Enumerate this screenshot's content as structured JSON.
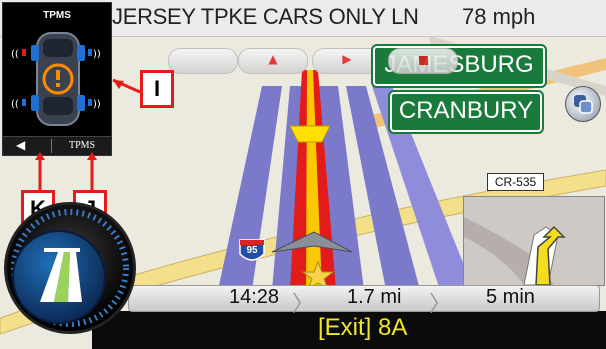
{
  "topbar": {
    "street_name": "JERSEY TPKE CARS ONLY LN",
    "speed": "78 mph"
  },
  "controls": {
    "pills": [
      "back",
      "up",
      "forward",
      "stop"
    ]
  },
  "signs": {
    "sign1": "JAMESBURG",
    "sign2": "CRANBURY"
  },
  "map": {
    "road_label": "CR-535",
    "interstate_shield": "95"
  },
  "tpms": {
    "title": "TPMS",
    "button_label": "TPMS"
  },
  "callouts": {
    "i": "I",
    "j": "J",
    "k": "K"
  },
  "info": {
    "time": "14:28",
    "distance": "1.7 mi",
    "duration": "5 min",
    "exit": "[Exit] 8A"
  },
  "colors": {
    "sign_green": "#1a7a3b",
    "route_red": "#e31b1b",
    "lane_blue": "#7b79c9",
    "exit_text": "#f2e629"
  }
}
